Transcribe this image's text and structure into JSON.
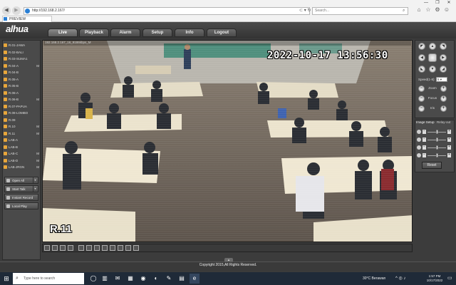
{
  "browser": {
    "url": "http://192.168.2.167/",
    "search_placeholder": "Search...",
    "tab_title": "PREVIEW",
    "nav_back": "◀",
    "nav_forward": "▶",
    "address_actions": "⊂ ▾ ↻",
    "search_icon": "⌕",
    "toolbar_icons": [
      "⌂",
      "☆",
      "⚙",
      "☺"
    ],
    "window_controls": [
      "—",
      "❐",
      "✕"
    ]
  },
  "app": {
    "logo": "alhua",
    "nav_tabs": [
      "Live",
      "Playback",
      "Alarm",
      "Setup",
      "Info",
      "Logout"
    ],
    "active_tab": "Live"
  },
  "channels": [
    {
      "label": "R.01-JAWA",
      "flag": ""
    },
    {
      "label": "R.02-BALI",
      "flag": ""
    },
    {
      "label": "R.03-SUMA1",
      "flag": ""
    },
    {
      "label": "R.04-A",
      "flag": "M"
    },
    {
      "label": "R.04-B",
      "flag": ""
    },
    {
      "label": "R.05-A",
      "flag": ""
    },
    {
      "label": "R.05-B",
      "flag": ""
    },
    {
      "label": "R.06-A",
      "flag": ""
    },
    {
      "label": "R.06-B",
      "flag": "M"
    },
    {
      "label": "R.07-PAPUA",
      "flag": ""
    },
    {
      "label": "R.08-LOMBO",
      "flag": ""
    },
    {
      "label": "R.09",
      "flag": ""
    },
    {
      "label": "R.10",
      "flag": "M"
    },
    {
      "label": "R.11",
      "flag": "M"
    },
    {
      "label": "LAB-A",
      "flag": ""
    },
    {
      "label": "LAB-B",
      "flag": ""
    },
    {
      "label": "LAB-C",
      "flag": "M"
    },
    {
      "label": "LAB-D",
      "flag": "M"
    },
    {
      "label": "LAB-JRGN",
      "flag": "M"
    },
    {
      "label": "LAB-E",
      "flag": ""
    }
  ],
  "side_buttons": {
    "open_all": "Open All",
    "start_talk": "Start Talk",
    "instant_record": "Instant Record",
    "local_play": "Local Play",
    "dropdown_arrow": "▾"
  },
  "video": {
    "info": "192.168.2.167_16_9186kbps_M",
    "timestamp": "2022-10-17 13:56:30",
    "channel_osd": "R.11"
  },
  "ptz": {
    "arrows": [
      "▲",
      "▶",
      "▼",
      "◀",
      "◤",
      "◥",
      "◢",
      "◣"
    ],
    "speed_label": "Speed(1-8):",
    "speed_value": "5 ▾",
    "zoom_label": "Zoom",
    "focus_label": "Focus",
    "iris_label": "Iris",
    "minus": "−",
    "plus": "+"
  },
  "image_setup": {
    "tab_image": "Image Setup",
    "tab_relay": "Relay-out",
    "levels": [
      0.5,
      0.5,
      0.5,
      0.5
    ],
    "minus": "−",
    "plus": "+",
    "reset": "Reset"
  },
  "footer": {
    "copyright": "Copyright 2015,All Rights Reserved.",
    "collapse_icon": "▲"
  },
  "taskbar": {
    "start_icon": "⊞",
    "search_placeholder": "Type here to search",
    "search_icon": "⌕",
    "app_icons": [
      "◯",
      "▥",
      "✉",
      "▦",
      "◉",
      "◐",
      "✎",
      "▤",
      "e"
    ],
    "weather": "30°C  Berawan",
    "tray": "^ ◎ ♪",
    "time": "1:57 PM",
    "date": "10/17/2022",
    "notif_icon": "▭"
  },
  "colors": {
    "accent": "#e8a63a",
    "header_bg": "#3a3a3a",
    "taskbar_bg": "#1f2a38"
  }
}
